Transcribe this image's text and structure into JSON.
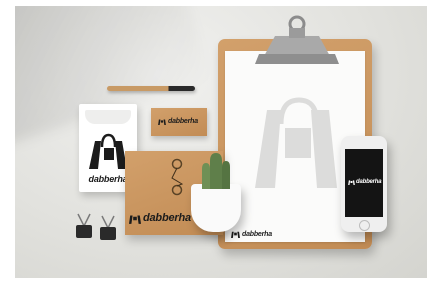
{
  "brand": {
    "name": "dabberha",
    "color_kraft": "#c9965f",
    "color_dark": "#1c1c1c"
  },
  "icons": {
    "logo": "shopping-bag-logo-icon",
    "clip": "binder-clip-icon",
    "plant": "cactus-icon"
  }
}
